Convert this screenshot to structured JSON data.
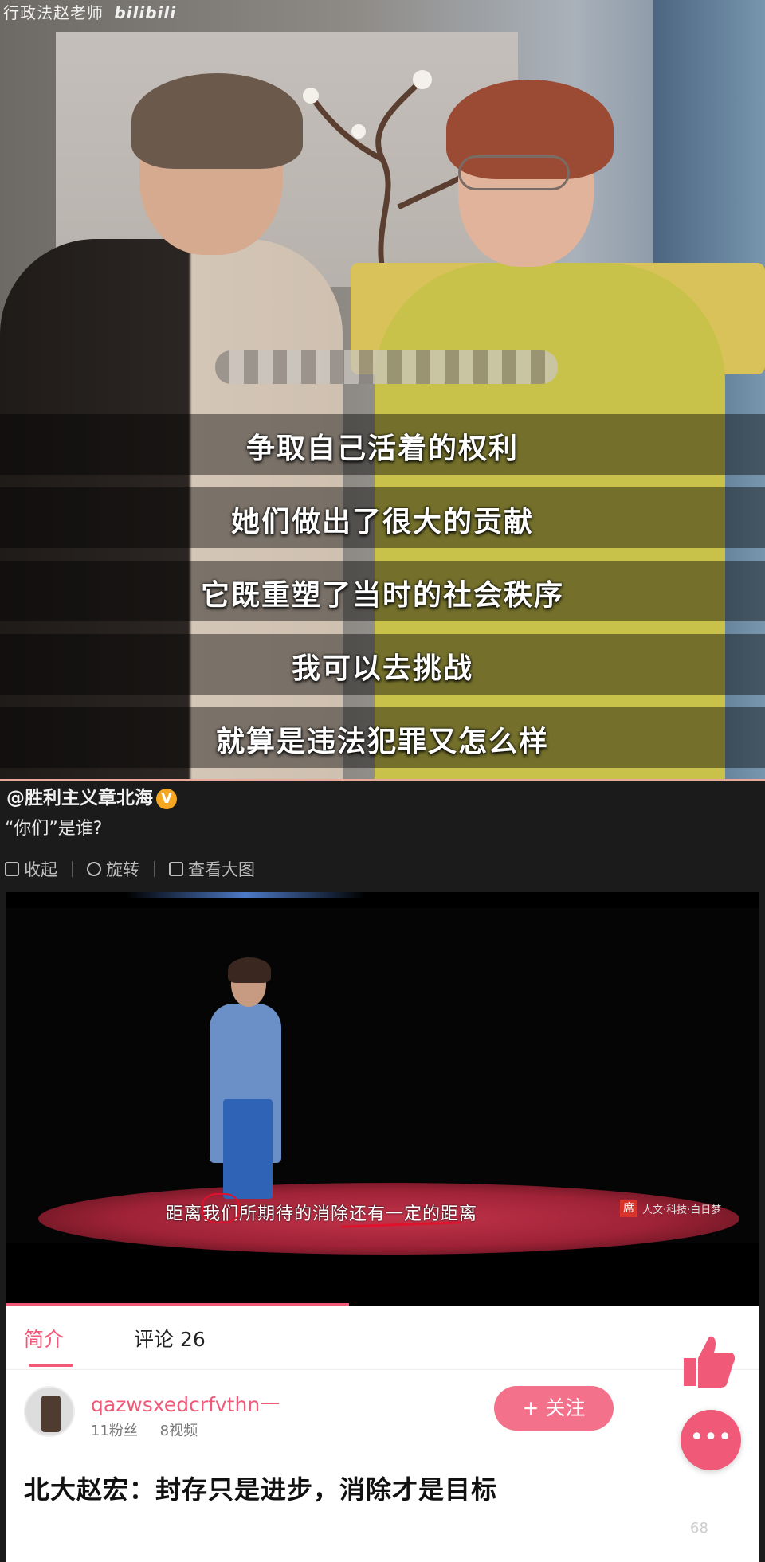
{
  "top_video": {
    "channel_mark": "行政法赵老师",
    "channel_brand": "bilibili",
    "subtitles": [
      "争取自己活着的权利",
      "她们做出了很大的贡献",
      "它既重塑了当时的社会秩序",
      "我可以去挑战",
      "就算是违法犯罪又怎么样"
    ]
  },
  "post": {
    "author": "@胜利主义章北海",
    "verified_mark": "V",
    "text": "“你们”是谁?",
    "toolbar": {
      "collapse": "收起",
      "rotate": "旋转",
      "view_large": "查看大图"
    }
  },
  "embed": {
    "subtitle": "距离我们所期待的消除还有一定的距离",
    "watermark_logo": "席",
    "watermark_text": "人文·科技·白日梦",
    "tabs": [
      {
        "label": "简介"
      },
      {
        "label": "评论 26"
      }
    ],
    "uploader": {
      "name": "qazwsxedcrfvthn一",
      "fans": "11粉丝",
      "videos": "8视频",
      "follow_label": "+ 关注"
    },
    "video_title": "北大赵宏：封存只是进步，消除才是目标",
    "comment_count": "68",
    "chat_icon": "•••"
  },
  "colors": {
    "accent_pink": "#f05a78",
    "verified_orange": "#f5a623",
    "annotation_red": "#e0112a"
  }
}
